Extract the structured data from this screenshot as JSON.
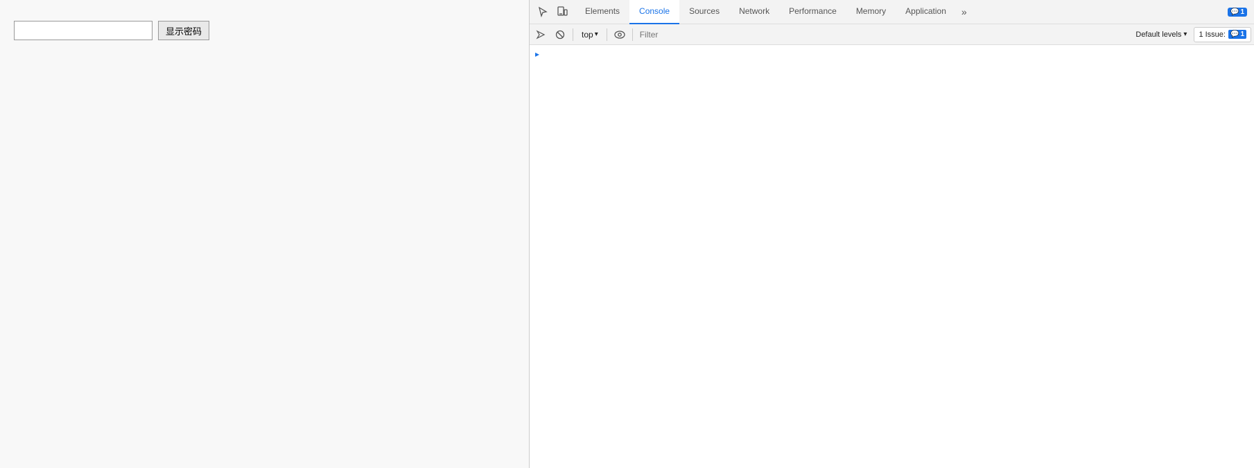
{
  "page": {
    "password_input_value": "",
    "show_password_btn_label": "显示密码"
  },
  "devtools": {
    "tabs": [
      {
        "id": "elements",
        "label": "Elements",
        "active": false
      },
      {
        "id": "console",
        "label": "Console",
        "active": true
      },
      {
        "id": "sources",
        "label": "Sources",
        "active": false
      },
      {
        "id": "network",
        "label": "Network",
        "active": false
      },
      {
        "id": "performance",
        "label": "Performance",
        "active": false
      },
      {
        "id": "memory",
        "label": "Memory",
        "active": false
      },
      {
        "id": "application",
        "label": "Application",
        "active": false
      }
    ],
    "tab_more_label": "»",
    "badge_count": "1",
    "console_toolbar": {
      "context": "top",
      "filter_placeholder": "Filter",
      "default_levels_label": "Default levels",
      "issues_label": "1 Issue:",
      "issues_count": "1"
    }
  }
}
